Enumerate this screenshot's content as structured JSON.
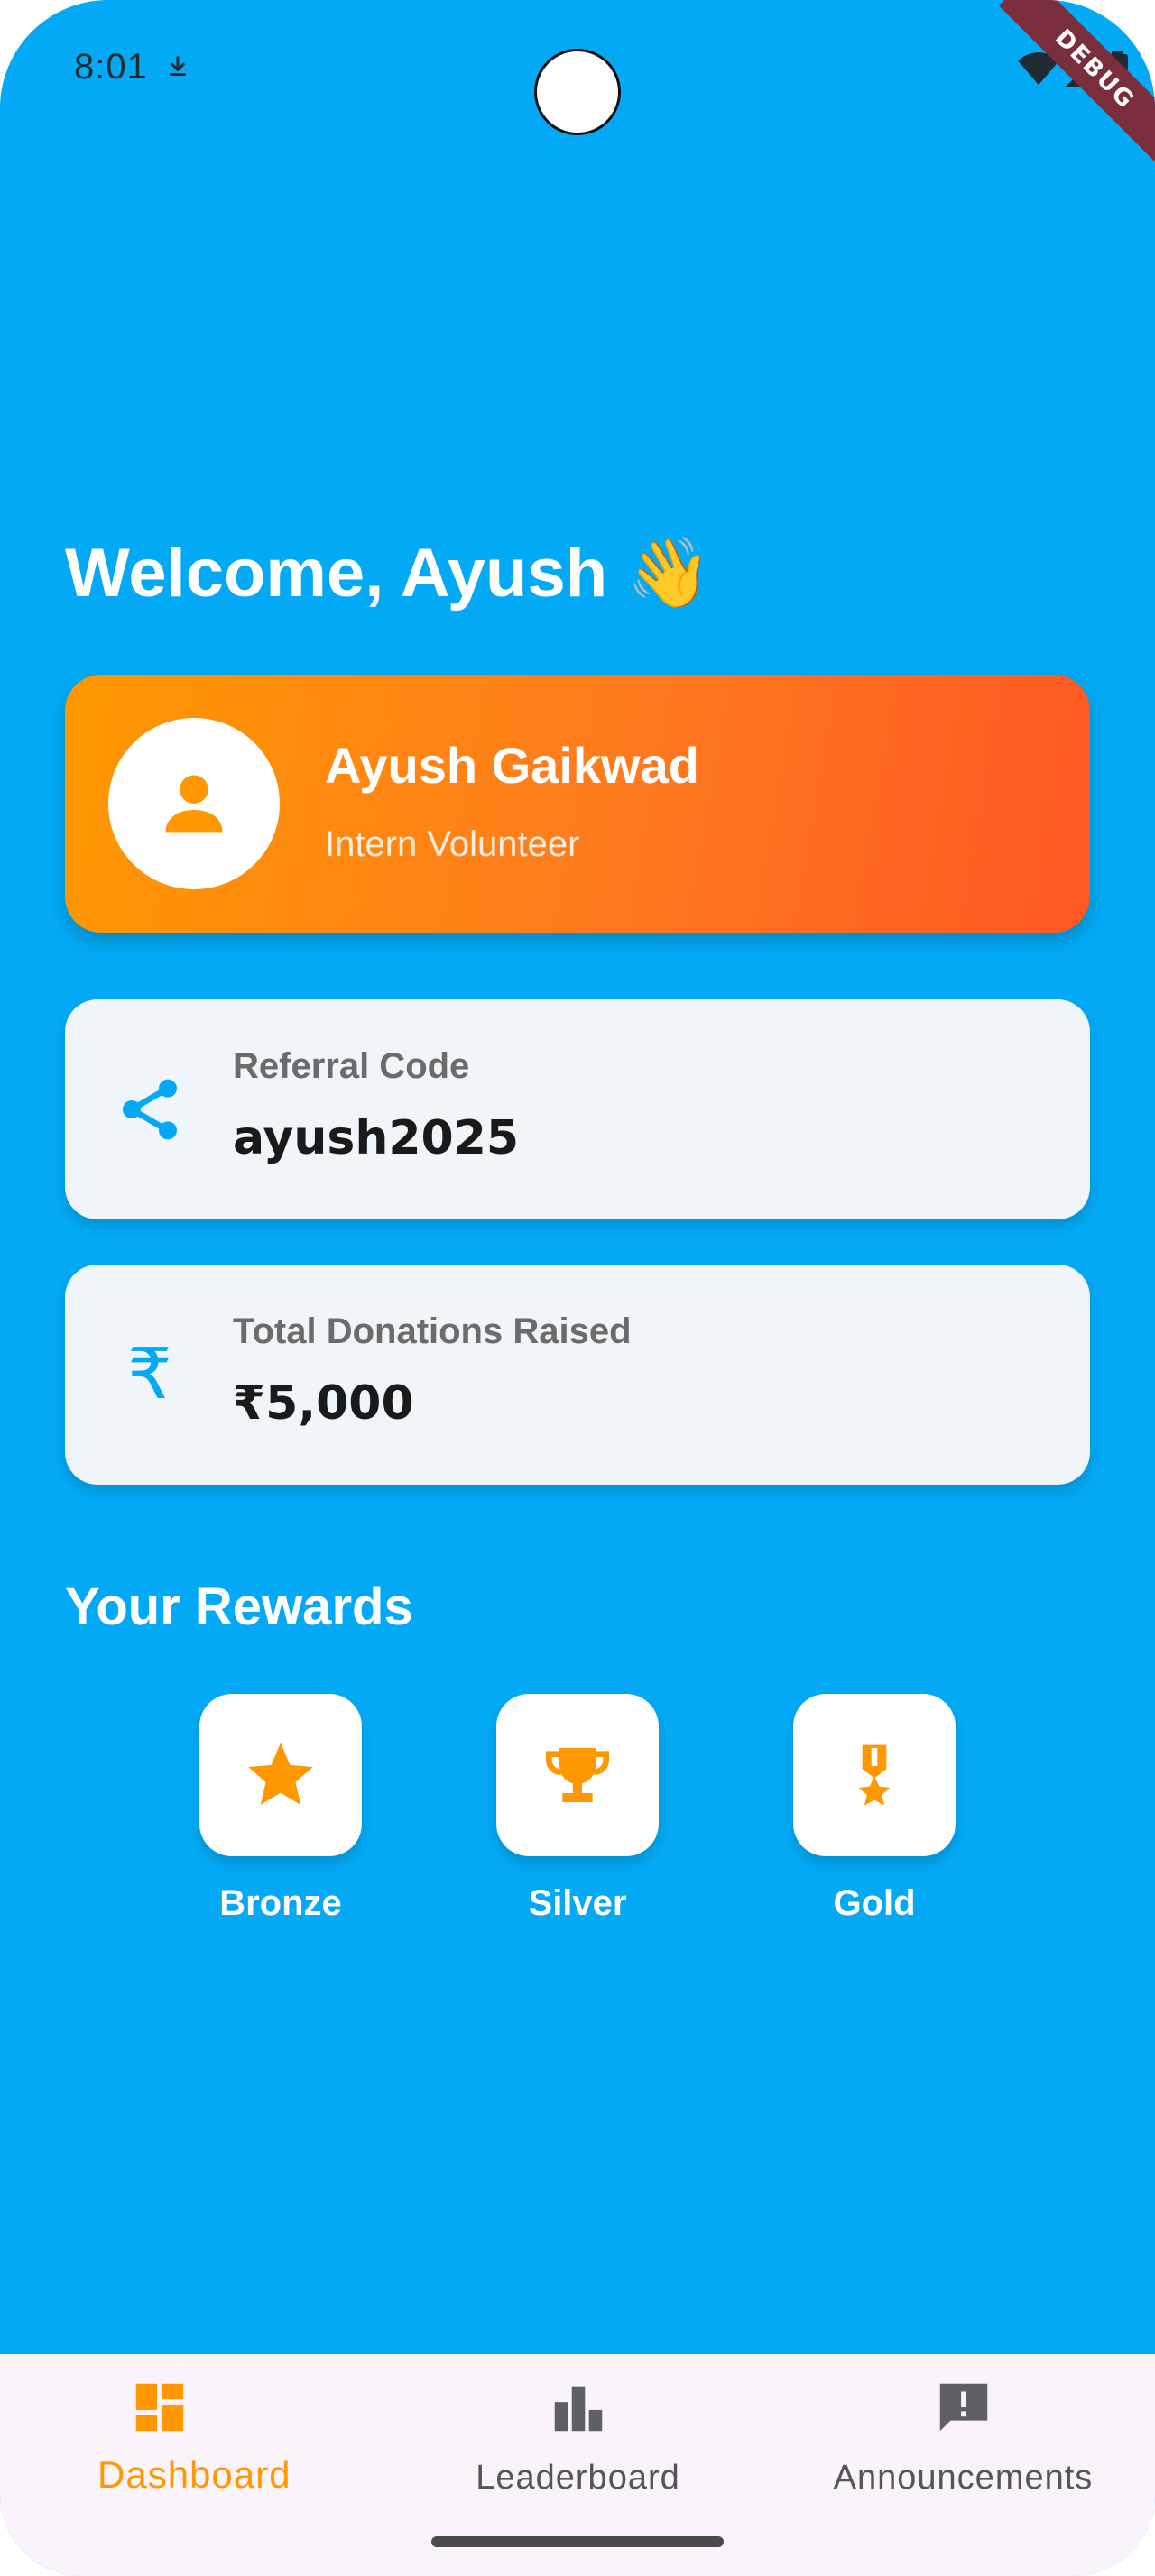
{
  "status_bar": {
    "time": "8:01",
    "debug_label": "DEBUG"
  },
  "welcome": {
    "text": "Welcome, Ayush 👋"
  },
  "profile": {
    "name": "Ayush Gaikwad",
    "role": "Intern Volunteer"
  },
  "referral": {
    "label": "Referral Code",
    "value": "ayush2025"
  },
  "donations": {
    "label": "Total Donations Raised",
    "value": "₹5,000"
  },
  "rewards": {
    "title": "Your Rewards",
    "items": [
      {
        "label": "Bronze",
        "icon": "star-icon"
      },
      {
        "label": "Silver",
        "icon": "trophy-icon"
      },
      {
        "label": "Gold",
        "icon": "medal-icon"
      }
    ]
  },
  "bottom_nav": {
    "items": [
      {
        "label": "Dashboard",
        "icon": "dashboard-icon",
        "active": true
      },
      {
        "label": "Leaderboard",
        "icon": "leaderboard-icon",
        "active": false
      },
      {
        "label": "Announcements",
        "icon": "announcement-icon",
        "active": false
      }
    ]
  },
  "colors": {
    "background": "#03A9F4",
    "accent": "#FF9800",
    "card_gradient_end": "#FF5722",
    "card_surface": "#F0F5F9",
    "nav_background": "#FAF3FB"
  }
}
